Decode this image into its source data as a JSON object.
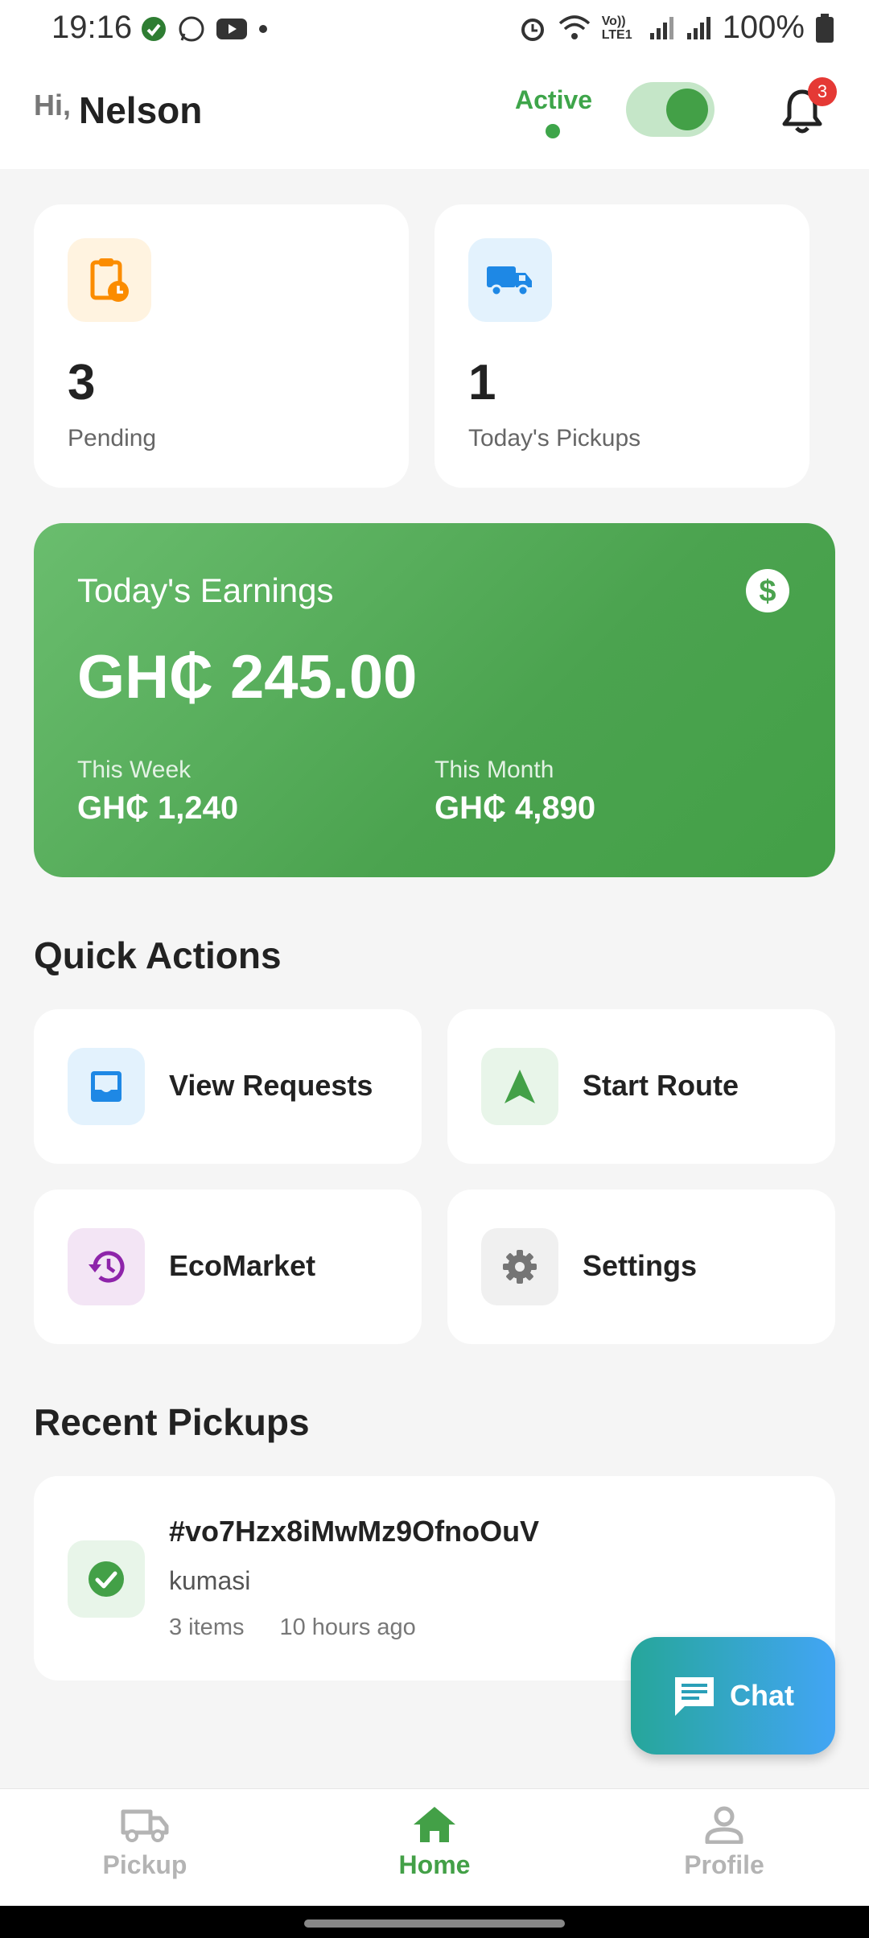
{
  "status_bar": {
    "time": "19:16",
    "battery": "100%",
    "network_label": "Vo)) LTE1"
  },
  "header": {
    "greeting": "Hi,",
    "user_name": "Nelson",
    "status_label": "Active",
    "toggle_on": true,
    "notification_count": "3"
  },
  "stats": [
    {
      "value": "3",
      "label": "Pending",
      "icon": "clipboard-clock-icon",
      "color": "#fb8c00",
      "bg": "#fff3e0"
    },
    {
      "value": "1",
      "label": "Today's Pickups",
      "icon": "truck-icon",
      "color": "#1e88e5",
      "bg": "#e3f2fd"
    }
  ],
  "earnings": {
    "title": "Today's Earnings",
    "amount": "GH₵ 245.00",
    "week_label": "This Week",
    "week_value": "GH₵ 1,240",
    "month_label": "This Month",
    "month_value": "GH₵ 4,890",
    "icon": "dollar-icon"
  },
  "quick_actions": {
    "title": "Quick Actions",
    "items": [
      {
        "label": "View Requests",
        "icon": "inbox-icon",
        "color": "#1e88e5",
        "bg": "#e3f2fd"
      },
      {
        "label": "Start Route",
        "icon": "navigation-icon",
        "color": "#43a047",
        "bg": "#e8f5e9"
      },
      {
        "label": "EcoMarket",
        "icon": "history-icon",
        "color": "#8e24aa",
        "bg": "#f3e5f5"
      },
      {
        "label": "Settings",
        "icon": "gear-icon",
        "color": "#757575",
        "bg": "#f0f0f0"
      }
    ]
  },
  "recent_pickups": {
    "title": "Recent Pickups",
    "items": [
      {
        "id": "#vo7Hzx8iMwMz9OfnoOuV",
        "location": "kumasi",
        "items": "3 items",
        "time": "10 hours ago",
        "status_icon": "check-circle-icon"
      }
    ]
  },
  "chat": {
    "label": "Chat"
  },
  "bottom_nav": {
    "items": [
      {
        "label": "Pickup",
        "icon": "truck-icon",
        "active": false
      },
      {
        "label": "Home",
        "icon": "home-icon",
        "active": true
      },
      {
        "label": "Profile",
        "icon": "person-icon",
        "active": false
      }
    ]
  },
  "colors": {
    "primary": "#43a047",
    "badge": "#e53935",
    "background": "#f5f5f5"
  }
}
